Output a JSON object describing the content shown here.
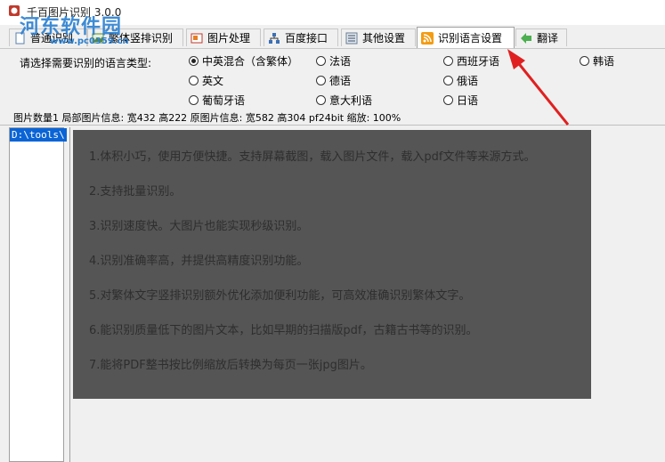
{
  "window": {
    "title": "千百图片识别 3.0.0"
  },
  "watermark": {
    "text": "河东软件园",
    "url": "www.pc0359.cn"
  },
  "tabs": [
    {
      "label": "普通识别",
      "icon": "document-icon"
    },
    {
      "label": "繁体竖排识别",
      "icon": "image-icon"
    },
    {
      "label": "图片处理",
      "icon": "image-edit-icon"
    },
    {
      "label": "百度接口",
      "icon": "network-icon"
    },
    {
      "label": "其他设置",
      "icon": "settings-icon"
    },
    {
      "label": "识别语言设置",
      "icon": "rss-icon"
    },
    {
      "label": "翻译",
      "icon": "translate-icon"
    }
  ],
  "language_settings": {
    "prompt": "请选择需要识别的语言类型:",
    "options": [
      {
        "label": "中英混合（含繁体）",
        "checked": true
      },
      {
        "label": "法语",
        "checked": false
      },
      {
        "label": "西班牙语",
        "checked": false
      },
      {
        "label": "韩语",
        "checked": false
      },
      {
        "label": "英文",
        "checked": false
      },
      {
        "label": "德语",
        "checked": false
      },
      {
        "label": "俄语",
        "checked": false
      },
      {
        "label": "葡萄牙语",
        "checked": false
      },
      {
        "label": "意大利语",
        "checked": false
      },
      {
        "label": "日语",
        "checked": false
      }
    ]
  },
  "status": {
    "text": "图片数量1 局部图片信息: 宽432 高222 原图片信息: 宽582 高304 pf24bit 缩放: 100%"
  },
  "file_list": {
    "selected": "D:\\tools\\"
  },
  "image_lines": [
    "1.体积小巧，使用方便快捷。支持屏幕截图，载入图片文件，载入pdf文件等来源方式。",
    "2.支持批量识别。",
    "3.识别速度快。大图片也能实现秒级识别。",
    "4.识别准确率高，并提供高精度识别功能。",
    "5.对繁体文字竖排识别额外优化添加便利功能，可高效准确识别繁体文字。",
    "6.能识别质量低下的图片文本，比如早期的扫描版pdf，古籍古书等的识别。",
    "7.能将PDF整书按比例缩放后转换为每页一张jpg图片。"
  ],
  "colors": {
    "arrow": "#e02020",
    "image_bg": "#555555",
    "selection": "#0a64d6"
  }
}
